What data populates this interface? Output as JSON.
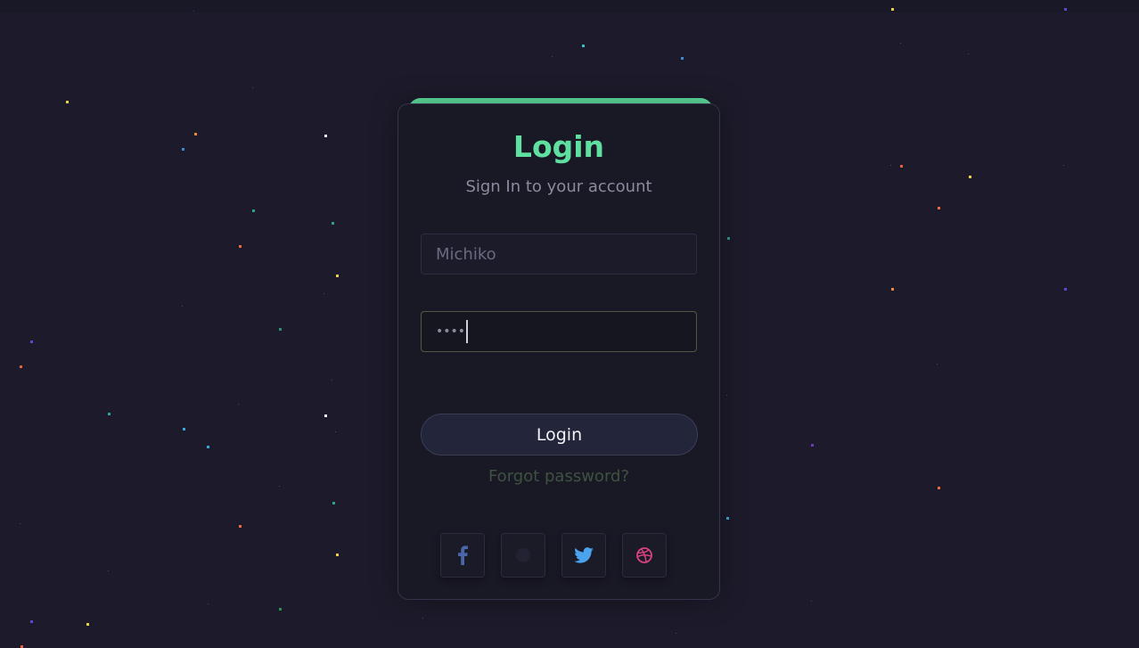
{
  "login_card": {
    "title": "Login",
    "subtitle": "Sign In to your account",
    "username_placeholder": "Michiko",
    "password_masked": "••••",
    "login_button": "Login",
    "forgot_link": "Forgot password?"
  },
  "social_buttons": [
    {
      "name": "facebook",
      "icon": "facebook-icon",
      "color": "#4a66a8"
    },
    {
      "name": "unknown",
      "icon": "hidden-icon",
      "color": "#2b2b3a"
    },
    {
      "name": "twitter",
      "icon": "twitter-icon",
      "color": "#4aa3ec"
    },
    {
      "name": "dribbble",
      "icon": "dribbble-icon",
      "color": "#d9427f"
    }
  ],
  "colors": {
    "background": "#1d1b2b",
    "accent": "#5fe0a0",
    "card": "#191825"
  }
}
